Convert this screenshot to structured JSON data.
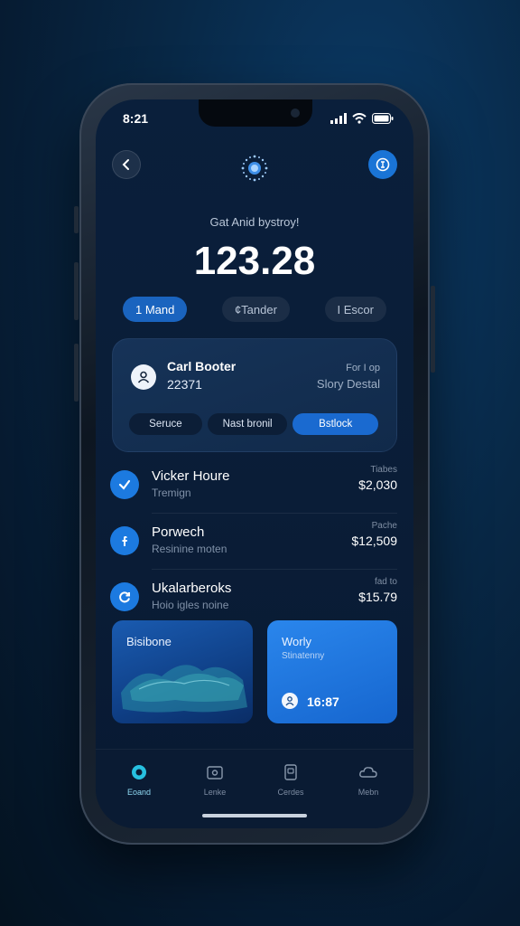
{
  "status_bar": {
    "time": "8:21"
  },
  "header": {
    "subtitle": "Gat Anid bystroy!",
    "balance": "123.28"
  },
  "filters": [
    {
      "label": "1 Mand",
      "active": true
    },
    {
      "label": "¢Tander",
      "active": false
    },
    {
      "label": "I Escor",
      "active": false
    }
  ],
  "card": {
    "name": "Carl Booter",
    "number": "22371",
    "right_small": "For I op",
    "right_label": "Slory Destal",
    "actions": [
      "Seruce",
      "Nast bronil",
      "Bstlock"
    ]
  },
  "transactions": [
    {
      "title": "Vicker Houre",
      "subtitle": "Tremign",
      "tag": "Tiabes",
      "amount": "$2,030",
      "icon": "check-icon"
    },
    {
      "title": "Porwech",
      "subtitle": "Resinine moten",
      "tag": "Pache",
      "amount": "$12,509",
      "icon": "facebook-icon"
    },
    {
      "title": "Ukalarberoks",
      "subtitle": "Hoio igles noine",
      "tag": "fad to",
      "amount": "$15.79",
      "icon": "refresh-icon"
    }
  ],
  "tiles": {
    "left_title": "Bisibone",
    "right_title": "Worly",
    "right_sub": "Stinatenny",
    "right_time": "16:87"
  },
  "tabbar": [
    {
      "label": "Eoand",
      "icon": "home-icon",
      "active": true
    },
    {
      "label": "Lenke",
      "icon": "wallet-icon",
      "active": false
    },
    {
      "label": "Cerdes",
      "icon": "cards-icon",
      "active": false
    },
    {
      "label": "Mebn",
      "icon": "cloud-icon",
      "active": false
    }
  ],
  "colors": {
    "accent": "#1a74d6",
    "background": "#0a1f3b",
    "card": "#163358"
  }
}
